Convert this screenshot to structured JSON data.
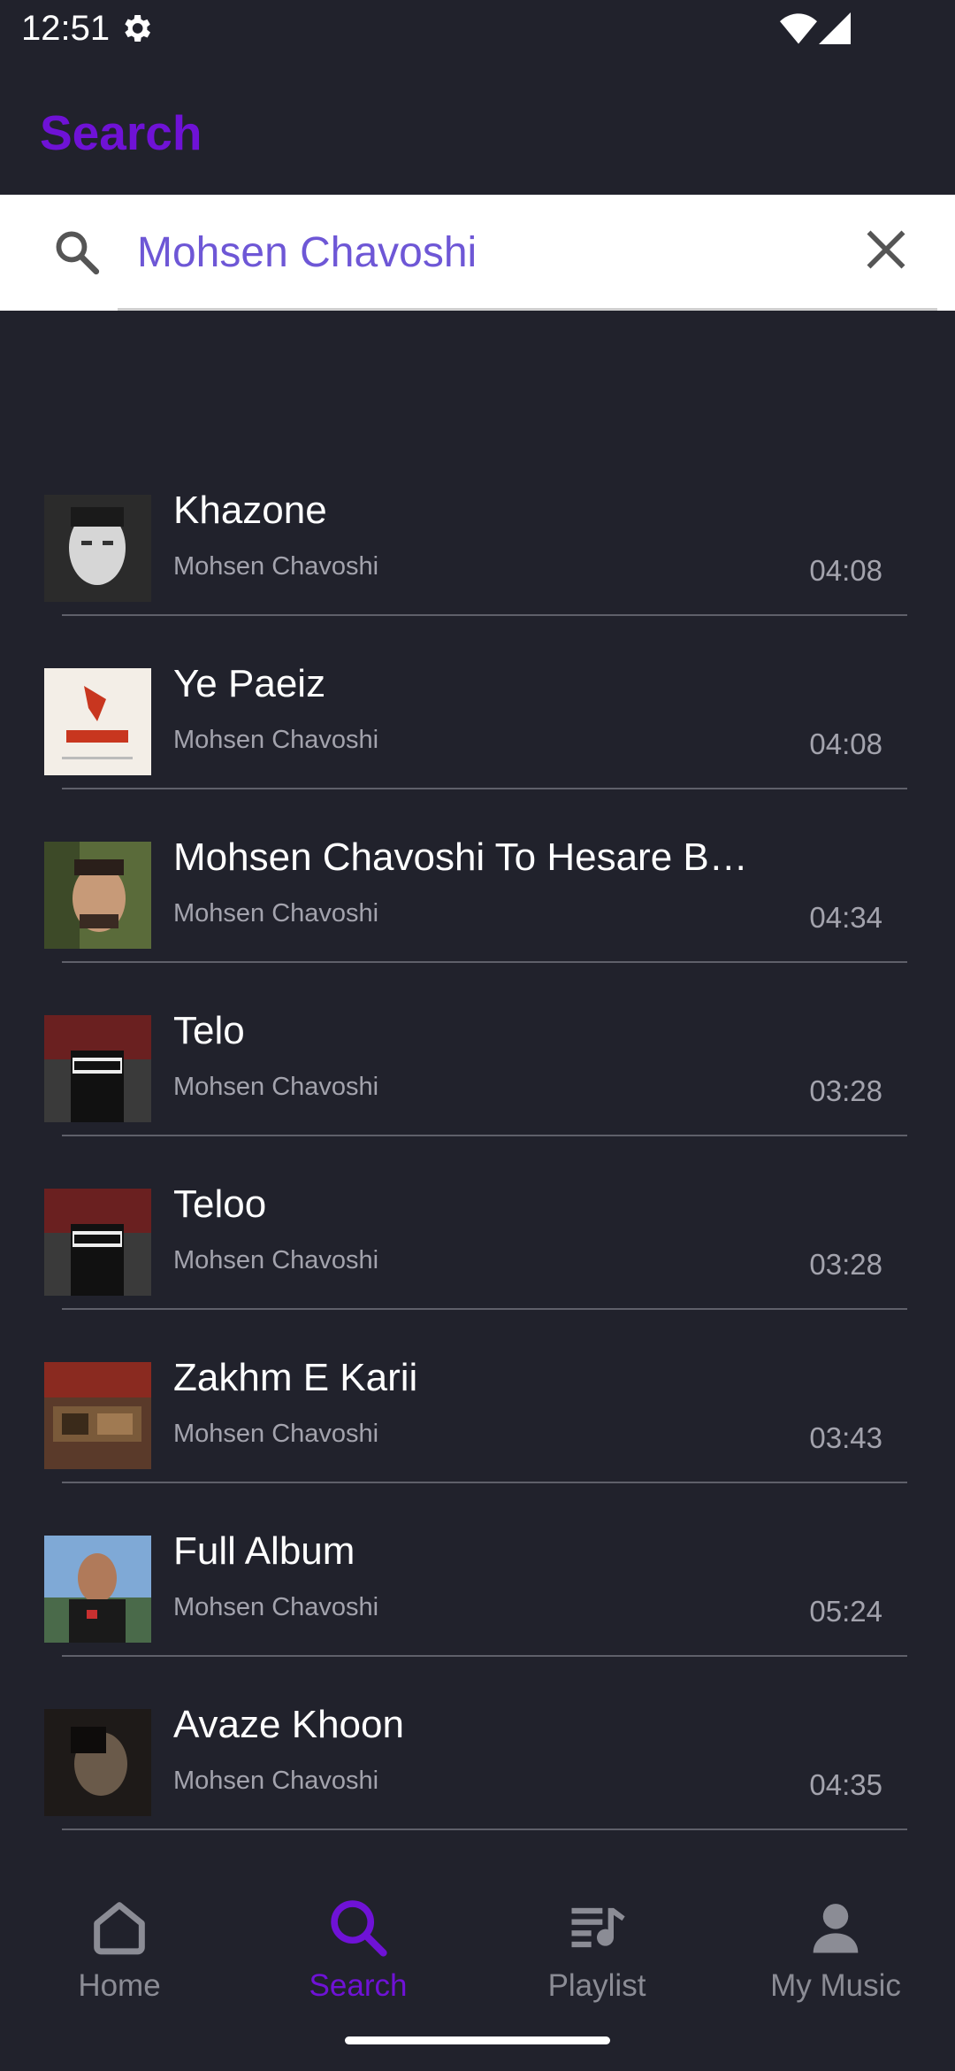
{
  "status_bar": {
    "time": "12:51"
  },
  "app_bar": {
    "title": "Search"
  },
  "search": {
    "query": "Mohsen Chavoshi"
  },
  "results": [
    {
      "title": "Khazone",
      "artist": "Mohsen Chavoshi",
      "duration": "04:08"
    },
    {
      "title": "Ye Paeiz",
      "artist": "Mohsen Chavoshi",
      "duration": "04:08"
    },
    {
      "title": "Mohsen Chavoshi To Hesare Ba...",
      "artist": "Mohsen Chavoshi",
      "duration": "04:34"
    },
    {
      "title": "Telo",
      "artist": "Mohsen Chavoshi",
      "duration": "03:28"
    },
    {
      "title": "Teloo",
      "artist": "Mohsen Chavoshi",
      "duration": "03:28"
    },
    {
      "title": "Zakhm E Karii",
      "artist": "Mohsen Chavoshi",
      "duration": "03:43"
    },
    {
      "title": "Full Album",
      "artist": "Mohsen Chavoshi",
      "duration": "05:24"
    },
    {
      "title": "Avaze Khoon",
      "artist": "Mohsen Chavoshi",
      "duration": "04:35"
    }
  ],
  "bottom_nav": {
    "home": "Home",
    "search": "Search",
    "playlist": "Playlist",
    "my_music": "My Music",
    "active": "search"
  },
  "colors": {
    "accent": "#6f12d6",
    "background": "#21222c",
    "query_text": "#6e57d6"
  },
  "icons": [
    "gear-icon",
    "wifi-icon",
    "signal-icon",
    "search-icon",
    "close-icon",
    "home-icon",
    "playlist-icon",
    "user-icon"
  ]
}
